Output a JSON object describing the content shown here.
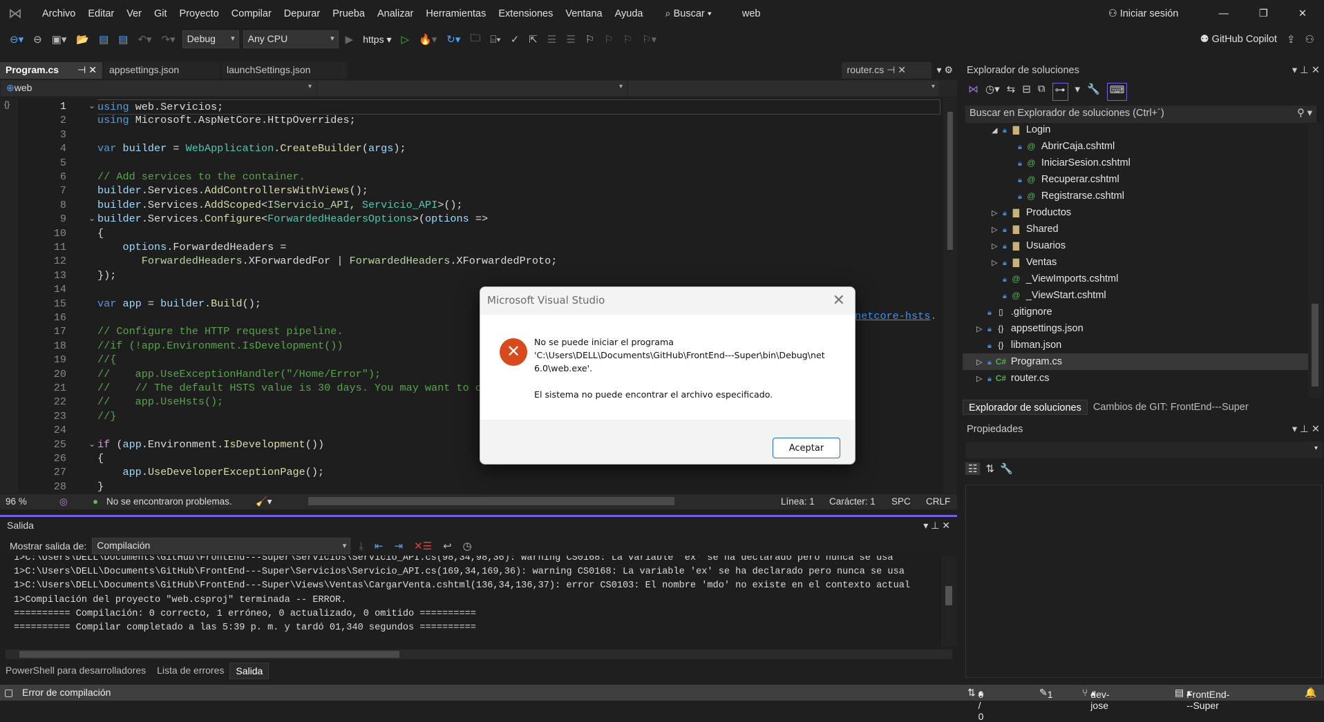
{
  "menu": {
    "items": [
      "Archivo",
      "Editar",
      "Ver",
      "Git",
      "Proyecto",
      "Compilar",
      "Depurar",
      "Prueba",
      "Analizar",
      "Herramientas",
      "Extensiones",
      "Ventana",
      "Ayuda"
    ],
    "search": "Buscar",
    "solution_name": "web",
    "sign_in": "Iniciar sesión"
  },
  "toolbar": {
    "config": "Debug",
    "platform": "Any CPU",
    "run_profile": "https",
    "copilot": "GitHub Copilot"
  },
  "tabs": {
    "open": [
      "Program.cs",
      "appsettings.json",
      "launchSettings.json"
    ],
    "right": "router.cs"
  },
  "navbar": {
    "project": "web"
  },
  "editor": {
    "lines": [
      [
        [
          "kw",
          "using"
        ],
        [
          "pl",
          " web.Servicios;"
        ]
      ],
      [
        [
          "kw",
          "using"
        ],
        [
          "pl",
          " Microsoft.AspNetCore.HttpOverrides;"
        ]
      ],
      [],
      [
        [
          "kw",
          "var"
        ],
        [
          "va",
          " builder"
        ],
        [
          "pl",
          " = "
        ],
        [
          "ty",
          "WebApplication"
        ],
        [
          "pl",
          "."
        ],
        [
          "me",
          "CreateBuilder"
        ],
        [
          "pl",
          "("
        ],
        [
          "va",
          "args"
        ],
        [
          "pl",
          ");"
        ]
      ],
      [],
      [
        [
          "cm",
          "// Add services to the container."
        ]
      ],
      [
        [
          "va",
          "builder"
        ],
        [
          "pl",
          ".Services."
        ],
        [
          "me",
          "AddControllersWithViews"
        ],
        [
          "pl",
          "();"
        ]
      ],
      [
        [
          "va",
          "builder"
        ],
        [
          "pl",
          ".Services."
        ],
        [
          "me",
          "AddScoped"
        ],
        [
          "pl",
          "<"
        ],
        [
          "it",
          "IServicio_API"
        ],
        [
          "pl",
          ", "
        ],
        [
          "ty",
          "Servicio_API"
        ],
        [
          "pl",
          ">();"
        ]
      ],
      [
        [
          "va",
          "builder"
        ],
        [
          "pl",
          ".Services."
        ],
        [
          "me",
          "Configure"
        ],
        [
          "pl",
          "<"
        ],
        [
          "ty",
          "ForwardedHeadersOptions"
        ],
        [
          "pl",
          ">("
        ],
        [
          "va",
          "options"
        ],
        [
          "pl",
          " =>"
        ]
      ],
      [
        [
          "pl",
          "{"
        ]
      ],
      [
        [
          "va",
          "    options"
        ],
        [
          "pl",
          ".ForwardedHeaders ="
        ]
      ],
      [
        [
          "it",
          "       ForwardedHeaders"
        ],
        [
          "pl",
          ".XForwardedFor | "
        ],
        [
          "it",
          "ForwardedHeaders"
        ],
        [
          "pl",
          ".XForwardedProto;"
        ]
      ],
      [
        [
          "pl",
          "});"
        ]
      ],
      [],
      [
        [
          "kw",
          "var"
        ],
        [
          "va",
          " app"
        ],
        [
          "pl",
          " = "
        ],
        [
          "va",
          "builder"
        ],
        [
          "pl",
          "."
        ],
        [
          "me",
          "Build"
        ],
        [
          "pl",
          "();"
        ]
      ],
      [],
      [
        [
          "cm",
          "// Configure the HTTP request pipeline."
        ]
      ],
      [
        [
          "cm",
          "//if (!app.Environment.IsDevelopment())"
        ]
      ],
      [
        [
          "cm",
          "//{"
        ]
      ],
      [
        [
          "cm",
          "//    app.UseExceptionHandler(\"/Home/Error\");"
        ]
      ],
      [
        [
          "cm",
          "//    // The default HSTS value is 30 days. You may want to c"
        ]
      ],
      [
        [
          "cm",
          "//    app.UseHsts();"
        ]
      ],
      [
        [
          "cm",
          "//}"
        ]
      ],
      [],
      [
        [
          "cf",
          "if"
        ],
        [
          "pl",
          " ("
        ],
        [
          "va",
          "app"
        ],
        [
          "pl",
          ".Environment."
        ],
        [
          "me",
          "IsDevelopment"
        ],
        [
          "pl",
          "())"
        ]
      ],
      [
        [
          "pl",
          "{"
        ]
      ],
      [
        [
          "va",
          "    app"
        ],
        [
          "pl",
          "."
        ],
        [
          "me",
          "UseDeveloperExceptionPage"
        ],
        [
          "pl",
          "();"
        ]
      ],
      [
        [
          "pl",
          "}"
        ]
      ]
    ],
    "hidden_link_tail": "netcore-hsts",
    "hidden_link_end": "."
  },
  "editor_status": {
    "zoom": "96 %",
    "problems": "No se encontraron problemas.",
    "line": "Línea: 1",
    "char": "Carácter: 1",
    "spacing": "SPC",
    "eol": "CRLF"
  },
  "output": {
    "title": "Salida",
    "show_label": "Mostrar salida de:",
    "source": "Compilación",
    "lines": [
      "1>C:\\Users\\DELL\\Documents\\GitHub\\FrontEnd---Super\\Servicios\\Servicio_API.cs(98,34,98,36): warning CS0168: La variable 'ex' se ha declarado pero nunca se usa",
      "1>C:\\Users\\DELL\\Documents\\GitHub\\FrontEnd---Super\\Servicios\\Servicio_API.cs(169,34,169,36): warning CS0168: La variable 'ex' se ha declarado pero nunca se usa",
      "1>C:\\Users\\DELL\\Documents\\GitHub\\FrontEnd---Super\\Views\\Ventas\\CargarVenta.cshtml(136,34,136,37): error CS0103: El nombre 'mdo' no existe en el contexto actual",
      "1>Compilación del proyecto \"web.csproj\" terminada -- ERROR.",
      "========== Compilación: 0 correcto, 1 erróneo, 0 actualizado, 0 omitido ==========",
      "========== Compilar completado a las 5:39 p. m. y tardó 01,340 segundos =========="
    ]
  },
  "bottom_tabs": [
    "PowerShell para desarrolladores",
    "Lista de errores",
    "Salida"
  ],
  "statusbar": {
    "message": "Error de compilación",
    "sync": "0 / 0",
    "changes": "1",
    "branch": "dev-jose",
    "repo": "FrontEnd---Super"
  },
  "solution_explorer": {
    "title": "Explorador de soluciones",
    "search_placeholder": "Buscar en Explorador de soluciones (Ctrl+´)",
    "items": [
      {
        "label": "Login",
        "level": 2,
        "type": "folder",
        "expander": "expanded"
      },
      {
        "label": "AbrirCaja.cshtml",
        "level": 3,
        "type": "razor"
      },
      {
        "label": "IniciarSesion.cshtml",
        "level": 3,
        "type": "razor"
      },
      {
        "label": "Recuperar.cshtml",
        "level": 3,
        "type": "razor"
      },
      {
        "label": "Registrarse.cshtml",
        "level": 3,
        "type": "razor"
      },
      {
        "label": "Productos",
        "level": 2,
        "type": "folder",
        "expander": "collapsed"
      },
      {
        "label": "Shared",
        "level": 2,
        "type": "folder",
        "expander": "collapsed"
      },
      {
        "label": "Usuarios",
        "level": 2,
        "type": "folder",
        "expander": "collapsed"
      },
      {
        "label": "Ventas",
        "level": 2,
        "type": "folder",
        "expander": "collapsed"
      },
      {
        "label": "_ViewImports.cshtml",
        "level": 2,
        "type": "razor"
      },
      {
        "label": "_ViewStart.cshtml",
        "level": 2,
        "type": "razor"
      },
      {
        "label": ".gitignore",
        "level": 1,
        "type": "file"
      },
      {
        "label": "appsettings.json",
        "level": 1,
        "type": "json",
        "expander": "collapsed"
      },
      {
        "label": "libman.json",
        "level": 1,
        "type": "json"
      },
      {
        "label": "Program.cs",
        "level": 1,
        "type": "cs",
        "expander": "collapsed",
        "selected": true
      },
      {
        "label": "router.cs",
        "level": 1,
        "type": "cs",
        "expander": "collapsed"
      }
    ],
    "tabs": [
      "Explorador de soluciones",
      "Cambios de GIT: FrontEnd---Super"
    ]
  },
  "properties": {
    "title": "Propiedades"
  },
  "dialog": {
    "title": "Microsoft Visual Studio",
    "line1": "No se puede iniciar el programa",
    "line2": "'C:\\Users\\DELL\\Documents\\GitHub\\FrontEnd---Super\\bin\\Debug\\net",
    "line3": "6.0\\web.exe'.",
    "line4": "El sistema no puede encontrar el archivo especificado.",
    "ok": "Aceptar",
    "icon": "error-icon"
  },
  "colors": {
    "accent": "#7160e8",
    "error": "#d84a1b"
  }
}
